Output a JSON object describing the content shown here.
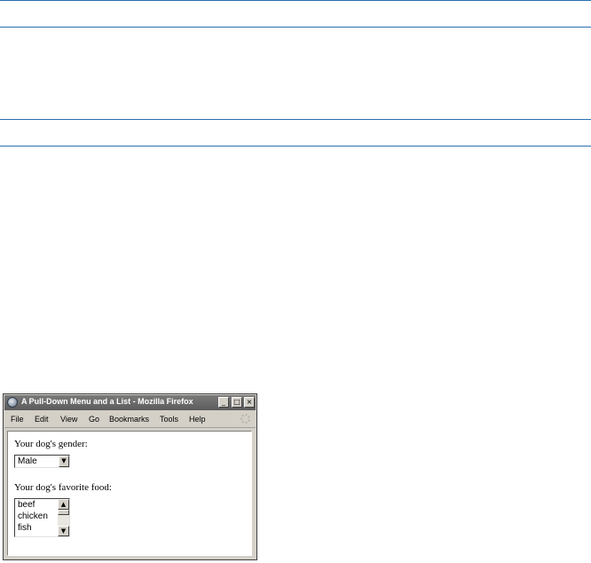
{
  "window": {
    "title": "A Pull-Down Menu and a List - Mozilla Firefox",
    "controls": {
      "minimize": "_",
      "maximize": "□",
      "close": "×"
    }
  },
  "menubar": {
    "items": [
      "File",
      "Edit",
      "View",
      "Go",
      "Bookmarks",
      "Tools",
      "Help"
    ]
  },
  "form": {
    "gender_label": "Your dog's gender:",
    "gender_value": "Male",
    "food_label": "Your dog's favorite food:",
    "food_options": [
      "beef",
      "chicken",
      "fish"
    ]
  },
  "icons": {
    "dropdown": "▼",
    "scroll_up": "▲",
    "scroll_down": "▼"
  },
  "colors": {
    "rule": "#2a6fb3",
    "titlebar": "#6a6a6a",
    "chrome": "#d4d0c8"
  }
}
